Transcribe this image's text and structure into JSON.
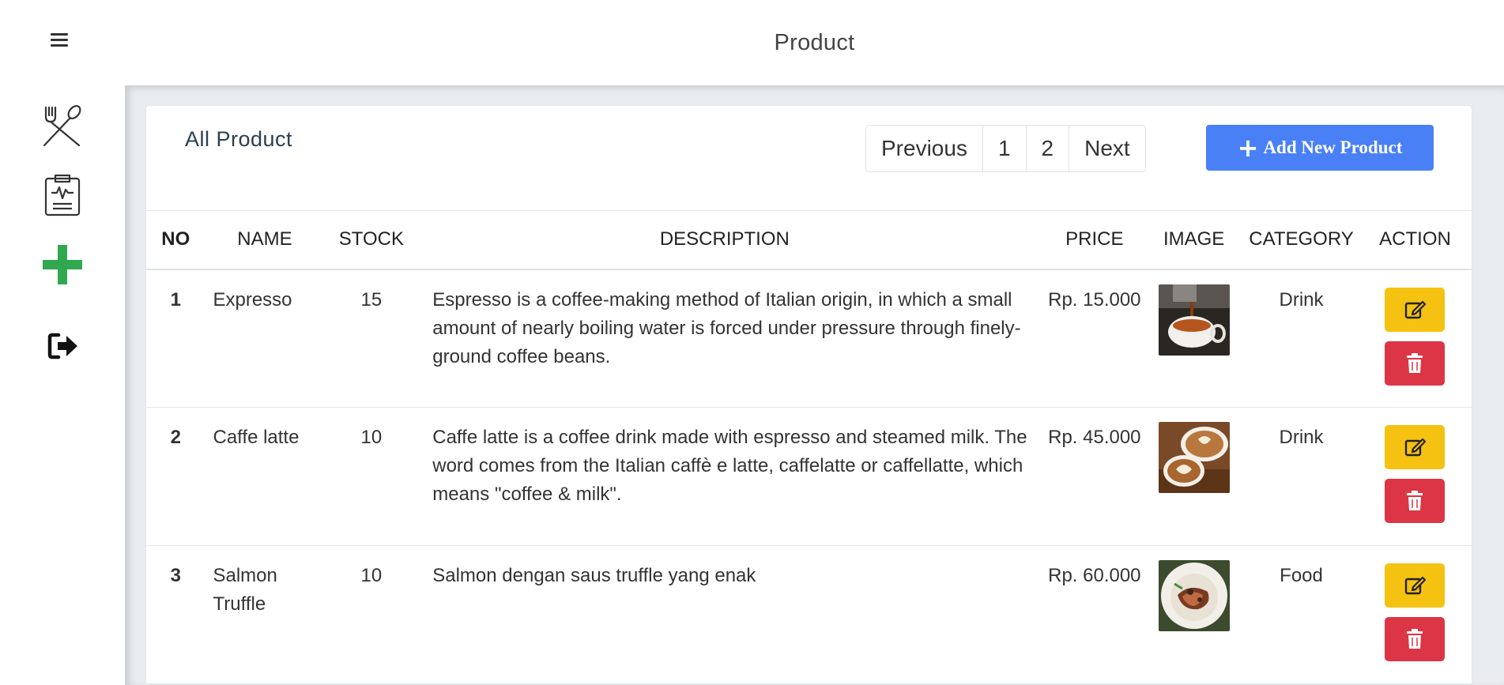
{
  "header": {
    "title": "Product"
  },
  "sidebar": {
    "items": [
      {
        "icon": "menu-icon"
      },
      {
        "icon": "utensils-icon"
      },
      {
        "icon": "clipboard-icon"
      },
      {
        "icon": "plus-icon"
      },
      {
        "icon": "logout-icon"
      }
    ]
  },
  "card": {
    "title": "All Product",
    "pagination": {
      "previous": "Previous",
      "page1": "1",
      "page2": "2",
      "next": "Next"
    },
    "add_button": {
      "plus": "+",
      "label": "Add New Product"
    }
  },
  "table": {
    "columns": [
      "NO",
      "NAME",
      "STOCK",
      "DESCRIPTION",
      "PRICE",
      "IMAGE",
      "CATEGORY",
      "ACTION"
    ],
    "rows": [
      {
        "no": "1",
        "name": "Expresso",
        "stock": "15",
        "description": "Espresso is a coffee-making method of Italian origin, in which a small amount of nearly boiling water is forced under pressure through finely-ground coffee beans.",
        "price": "Rp. 15.000",
        "category": "Drink"
      },
      {
        "no": "2",
        "name": "Caffe latte",
        "stock": "10",
        "description": "Caffe latte is a coffee drink made with espresso and steamed milk. The word comes from the Italian caffè e latte, caffelatte or caffellatte, which means \"coffee & milk\".",
        "price": "Rp. 45.000",
        "category": "Drink"
      },
      {
        "no": "3",
        "name": "Salmon Truffle",
        "stock": "10",
        "description": "Salmon dengan saus truffle yang enak",
        "price": "Rp. 60.000",
        "category": "Food"
      }
    ]
  },
  "colors": {
    "primary": "#4a80f5",
    "warning": "#f5c211",
    "danger": "#dc3545",
    "success": "#2fa84f"
  }
}
